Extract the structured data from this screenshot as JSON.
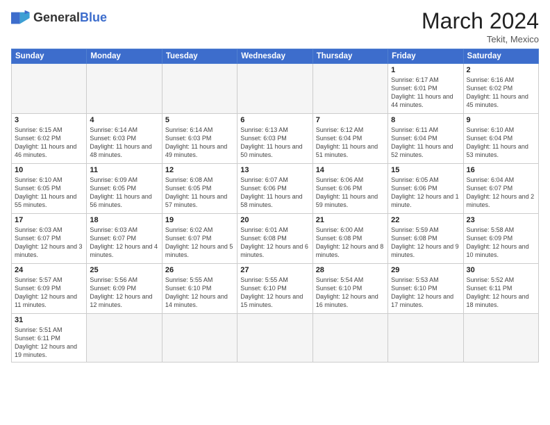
{
  "header": {
    "logo_general": "General",
    "logo_blue": "Blue",
    "title": "March 2024",
    "location": "Tekit, Mexico"
  },
  "days_of_week": [
    "Sunday",
    "Monday",
    "Tuesday",
    "Wednesday",
    "Thursday",
    "Friday",
    "Saturday"
  ],
  "weeks": [
    [
      {
        "day": "",
        "info": ""
      },
      {
        "day": "",
        "info": ""
      },
      {
        "day": "",
        "info": ""
      },
      {
        "day": "",
        "info": ""
      },
      {
        "day": "",
        "info": ""
      },
      {
        "day": "1",
        "info": "Sunrise: 6:17 AM\nSunset: 6:01 PM\nDaylight: 11 hours and 44 minutes."
      },
      {
        "day": "2",
        "info": "Sunrise: 6:16 AM\nSunset: 6:02 PM\nDaylight: 11 hours and 45 minutes."
      }
    ],
    [
      {
        "day": "3",
        "info": "Sunrise: 6:15 AM\nSunset: 6:02 PM\nDaylight: 11 hours and 46 minutes."
      },
      {
        "day": "4",
        "info": "Sunrise: 6:14 AM\nSunset: 6:03 PM\nDaylight: 11 hours and 48 minutes."
      },
      {
        "day": "5",
        "info": "Sunrise: 6:14 AM\nSunset: 6:03 PM\nDaylight: 11 hours and 49 minutes."
      },
      {
        "day": "6",
        "info": "Sunrise: 6:13 AM\nSunset: 6:03 PM\nDaylight: 11 hours and 50 minutes."
      },
      {
        "day": "7",
        "info": "Sunrise: 6:12 AM\nSunset: 6:04 PM\nDaylight: 11 hours and 51 minutes."
      },
      {
        "day": "8",
        "info": "Sunrise: 6:11 AM\nSunset: 6:04 PM\nDaylight: 11 hours and 52 minutes."
      },
      {
        "day": "9",
        "info": "Sunrise: 6:10 AM\nSunset: 6:04 PM\nDaylight: 11 hours and 53 minutes."
      }
    ],
    [
      {
        "day": "10",
        "info": "Sunrise: 6:10 AM\nSunset: 6:05 PM\nDaylight: 11 hours and 55 minutes."
      },
      {
        "day": "11",
        "info": "Sunrise: 6:09 AM\nSunset: 6:05 PM\nDaylight: 11 hours and 56 minutes."
      },
      {
        "day": "12",
        "info": "Sunrise: 6:08 AM\nSunset: 6:05 PM\nDaylight: 11 hours and 57 minutes."
      },
      {
        "day": "13",
        "info": "Sunrise: 6:07 AM\nSunset: 6:06 PM\nDaylight: 11 hours and 58 minutes."
      },
      {
        "day": "14",
        "info": "Sunrise: 6:06 AM\nSunset: 6:06 PM\nDaylight: 11 hours and 59 minutes."
      },
      {
        "day": "15",
        "info": "Sunrise: 6:05 AM\nSunset: 6:06 PM\nDaylight: 12 hours and 1 minute."
      },
      {
        "day": "16",
        "info": "Sunrise: 6:04 AM\nSunset: 6:07 PM\nDaylight: 12 hours and 2 minutes."
      }
    ],
    [
      {
        "day": "17",
        "info": "Sunrise: 6:03 AM\nSunset: 6:07 PM\nDaylight: 12 hours and 3 minutes."
      },
      {
        "day": "18",
        "info": "Sunrise: 6:03 AM\nSunset: 6:07 PM\nDaylight: 12 hours and 4 minutes."
      },
      {
        "day": "19",
        "info": "Sunrise: 6:02 AM\nSunset: 6:07 PM\nDaylight: 12 hours and 5 minutes."
      },
      {
        "day": "20",
        "info": "Sunrise: 6:01 AM\nSunset: 6:08 PM\nDaylight: 12 hours and 6 minutes."
      },
      {
        "day": "21",
        "info": "Sunrise: 6:00 AM\nSunset: 6:08 PM\nDaylight: 12 hours and 8 minutes."
      },
      {
        "day": "22",
        "info": "Sunrise: 5:59 AM\nSunset: 6:08 PM\nDaylight: 12 hours and 9 minutes."
      },
      {
        "day": "23",
        "info": "Sunrise: 5:58 AM\nSunset: 6:09 PM\nDaylight: 12 hours and 10 minutes."
      }
    ],
    [
      {
        "day": "24",
        "info": "Sunrise: 5:57 AM\nSunset: 6:09 PM\nDaylight: 12 hours and 11 minutes."
      },
      {
        "day": "25",
        "info": "Sunrise: 5:56 AM\nSunset: 6:09 PM\nDaylight: 12 hours and 12 minutes."
      },
      {
        "day": "26",
        "info": "Sunrise: 5:55 AM\nSunset: 6:10 PM\nDaylight: 12 hours and 14 minutes."
      },
      {
        "day": "27",
        "info": "Sunrise: 5:55 AM\nSunset: 6:10 PM\nDaylight: 12 hours and 15 minutes."
      },
      {
        "day": "28",
        "info": "Sunrise: 5:54 AM\nSunset: 6:10 PM\nDaylight: 12 hours and 16 minutes."
      },
      {
        "day": "29",
        "info": "Sunrise: 5:53 AM\nSunset: 6:10 PM\nDaylight: 12 hours and 17 minutes."
      },
      {
        "day": "30",
        "info": "Sunrise: 5:52 AM\nSunset: 6:11 PM\nDaylight: 12 hours and 18 minutes."
      }
    ],
    [
      {
        "day": "31",
        "info": "Sunrise: 5:51 AM\nSunset: 6:11 PM\nDaylight: 12 hours and 19 minutes."
      },
      {
        "day": "",
        "info": ""
      },
      {
        "day": "",
        "info": ""
      },
      {
        "day": "",
        "info": ""
      },
      {
        "day": "",
        "info": ""
      },
      {
        "day": "",
        "info": ""
      },
      {
        "day": "",
        "info": ""
      }
    ]
  ]
}
